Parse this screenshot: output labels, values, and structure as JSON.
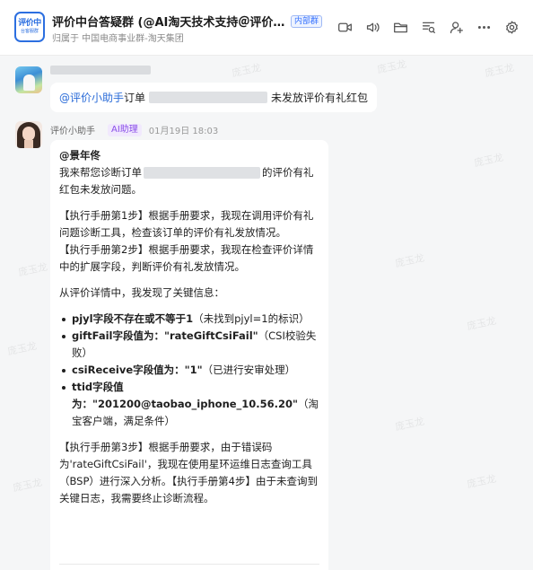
{
  "header": {
    "avatar_line1": "评价中",
    "avatar_line2": "台客服群",
    "title": "评价中台答疑群 (@AI淘天技术支持＠评价小助手…",
    "badge": "内部群",
    "subtitle": "归属于 中国电商事业群-淘天集团"
  },
  "toolbar_icons": [
    "video-call-icon",
    "voice-call-icon",
    "folder-icon",
    "search-history-icon",
    "add-member-icon",
    "more-icon",
    "settings-icon"
  ],
  "watermark": "庞玉龙",
  "messages": {
    "first": {
      "mention": "@评价小助手",
      "prefix": "订单",
      "suffix": "未发放评价有礼红包"
    },
    "reply": {
      "sender": "评价小助手",
      "ai_badge": "AI助理",
      "timestamp": "01月19日 18:03",
      "at_user": "@景年佟",
      "intro_a": "我来帮您诊断订单",
      "intro_b": "的评价有礼红包未发放问题。",
      "step1": "【执行手册第1步】根据手册要求，我现在调用评价有礼问题诊断工具，检查该订单的评价有礼发放情况。",
      "step2": "【执行手册第2步】根据手册要求，我现在检查评价详情中的扩展字段，判断评价有礼发放情况。",
      "findings_intro": "从评价详情中，我发现了关键信息：",
      "findings": [
        {
          "bold": "pjyl字段不存在或不等于1",
          "rest": "（未找到pjyl=1的标识）"
        },
        {
          "bold": "giftFail字段值为：\"rateGiftCsiFail\"",
          "rest": "（CSI校验失败）"
        },
        {
          "bold": "csiReceive字段值为：\"1\"",
          "rest": "（已进行安审处理）"
        },
        {
          "bold": "ttid字段值为：\"201200@taobao_iphone_10.56.20\"",
          "rest": "（淘宝客户端，满足条件）"
        }
      ],
      "step3": "【执行手册第3步】根据手册要求，由于错误码为'rateGiftCsiFail'，我现在使用星环运维日志查询工具（BSP）进行深入分析。【执行手册第4步】由于未查询到关键日志，我需要终止诊断流程。"
    }
  }
}
